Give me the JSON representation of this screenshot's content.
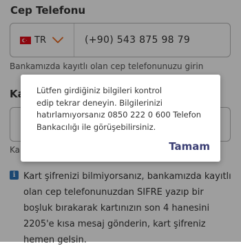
{
  "form": {
    "phone_section_title": "Cep Telefonu",
    "country_code": "TR",
    "phone_number": "(+90) 543 875 98 79",
    "phone_helper": "Bankamızda kayıtlı olan cep telefonunuzu girin",
    "second_label_partial": "Ka",
    "second_helper_partial": "Ka",
    "info_text": "Kart şifrenizi bilmiyorsanız, bankamızda kayıtlı olan cep telefonunuzdan SIFRE yazıp bir boşluk bırakarak kartınızın son 4 hanesini 2205'e kısa mesaj gönderin, kart şifreniz hemen gelsin."
  },
  "dialog": {
    "message_lines": [
      "Lütfen girdiğiniz bilgileri kontrol",
      "edip tekrar deneyin. Bilgilerinizi",
      "hatırlamıyorsanız 0850 222 0 600 Telefon",
      "Bankacılığı ile görüşebilirsiniz."
    ],
    "ok_label": "Tamam"
  },
  "icons": {
    "flag": "turkey-flag-icon",
    "dropdown": "chevron-down-icon",
    "info": "info-icon"
  },
  "colors": {
    "accent_orange": "#e8661c",
    "dialog_button": "#3b3f74",
    "info_blue": "#2e74b8",
    "flag_red": "#e30a17"
  }
}
